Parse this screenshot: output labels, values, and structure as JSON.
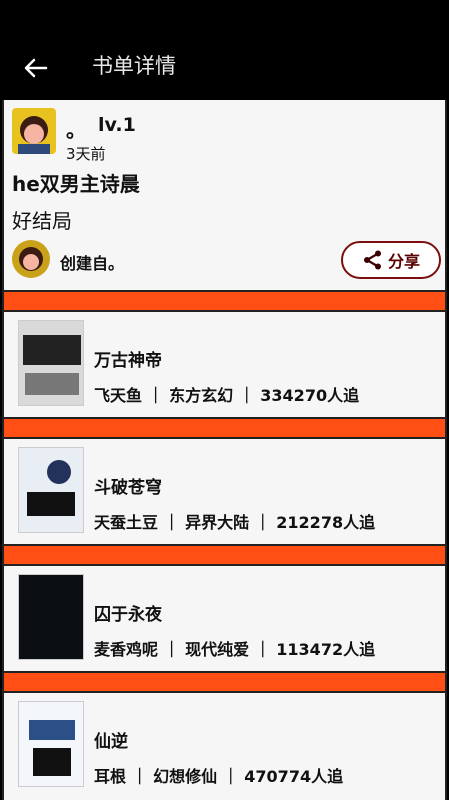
{
  "header": {
    "title": "书单详情"
  },
  "profile": {
    "name": "。",
    "level": "lv.1",
    "time": "3天前",
    "list_title": "he双男主诗晨",
    "list_desc": "好结局",
    "creator": "创建自。",
    "share_label": "分享"
  },
  "books": [
    {
      "title": "万古神帝",
      "meta": "飞天鱼 ｜ 东方玄幻 ｜ 334270人追"
    },
    {
      "title": "斗破苍穹",
      "meta": "天蚕土豆 ｜ 异界大陆 ｜ 212278人追"
    },
    {
      "title": "囚于永夜",
      "meta": "麦香鸡呢 ｜ 现代纯爱 ｜ 113472人追"
    },
    {
      "title": "仙逆",
      "meta": "耳根 ｜ 幻想修仙 ｜ 470774人追"
    }
  ],
  "colors": {
    "accent": "#ff4f14",
    "share_border": "#7b0f0f"
  },
  "icons": {
    "back": "arrow-left-icon",
    "share": "share-icon"
  }
}
